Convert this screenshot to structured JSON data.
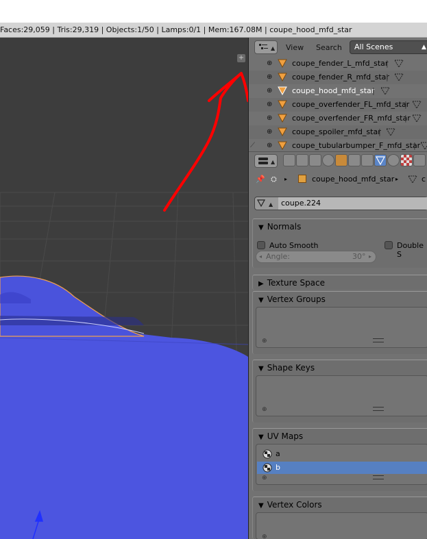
{
  "info_bar": {
    "text": "Faces:29,059 | Tris:29,319 | Objects:1/50 | Lamps:0/1 | Mem:167.08M | coupe_hood_mfd_star"
  },
  "outliner": {
    "menu_view": "View",
    "menu_search": "Search",
    "scenes_dropdown": "All Scenes",
    "items": [
      {
        "name": "coupe_fender_L_mfd_star"
      },
      {
        "name": "coupe_fender_R_mfd_star"
      },
      {
        "name": "coupe_hood_mfd_star",
        "selected": true
      },
      {
        "name": "coupe_overfender_FL_mfd_star"
      },
      {
        "name": "coupe_overfender_FR_mfd_star"
      },
      {
        "name": "coupe_spoiler_mfd_star"
      },
      {
        "name": "coupe_tubularbumper_F_mfd_star"
      }
    ]
  },
  "properties": {
    "context_object": "coupe_hood_mfd_star",
    "context_trailing": "c",
    "mesh_datablock": "coupe.224",
    "normals": {
      "title": "Normals",
      "auto_smooth_label": "Auto Smooth",
      "double_sided_label": "Double S",
      "angle_label": "Angle:",
      "angle_value": "30°"
    },
    "texture_space": {
      "title": "Texture Space"
    },
    "vertex_groups": {
      "title": "Vertex Groups"
    },
    "shape_keys": {
      "title": "Shape Keys"
    },
    "uv_maps": {
      "title": "UV Maps",
      "items": [
        {
          "name": "a"
        },
        {
          "name": "b",
          "selected": true
        }
      ]
    },
    "vertex_colors": {
      "title": "Vertex Colors"
    }
  },
  "colors": {
    "mesh_blue": "#4c55e0",
    "selection_outline": "#f0a050",
    "annotation_red": "#ff0000",
    "active_row": "#5680c2"
  },
  "icons": {
    "viewport_corner": "plus-icon",
    "mesh": "mesh-triangle-icon",
    "uv": "uv-map-icon"
  }
}
